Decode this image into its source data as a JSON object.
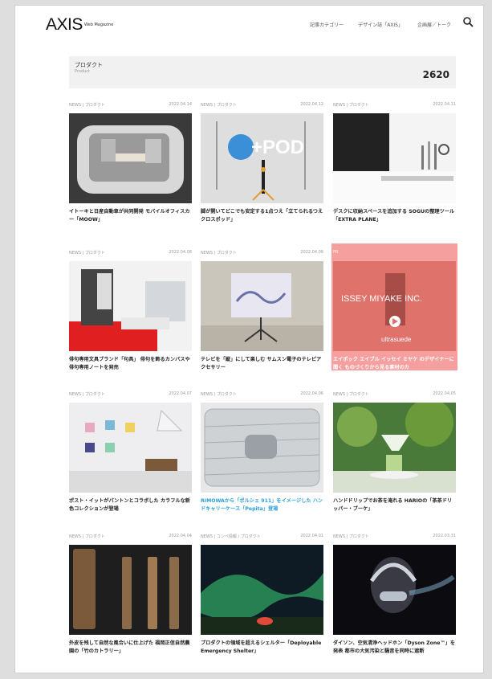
{
  "header": {
    "logo": "AXIS",
    "logo_sub": "Web Magazine",
    "nav": [
      "記事カテゴリー",
      "デザイン誌「AXIS」",
      "企画展／トーク"
    ]
  },
  "category": {
    "title": "プロダクト",
    "subtitle": "Product",
    "count": "2620"
  },
  "articles": [
    {
      "cat": "NEWS | プロダクト",
      "date": "2022.04.14",
      "title": "イトーキと日産自動車が共同開発 モバイルオフィスカー「MOOW」"
    },
    {
      "cat": "NEWS | プロダクト",
      "date": "2022.04.12",
      "title": "脚が開いてどこでも安定する1点つえ「立てられるつえ クロスポッド」"
    },
    {
      "cat": "NEWS | プロダクト",
      "date": "2022.04.11",
      "title": "デスクに収納スペースを追加する SOGUの整理ツール「EXTRA PLANE」"
    },
    {
      "cat": "NEWS | プロダクト",
      "date": "2022.04.08",
      "title": "俳句専用文具ブランド「句具」 俳句を飾るカンバスや俳句専用ノートを発売"
    },
    {
      "cat": "NEWS | プロダクト",
      "date": "2022.04.08",
      "title": "テレビを「縦」にして楽しむ サムスン電子のテレビアクセサリー"
    },
    {
      "cat": "PR",
      "date": "",
      "title": "エイポック エイブル イッセイ ミヤケ のデザイナーに聞く ものづくりから見る素材のカ"
    },
    {
      "cat": "NEWS | プロダクト",
      "date": "2022.04.07",
      "title": "ポスト・イットがパントンとコラボした カラフルな新色コレクションが登場"
    },
    {
      "cat": "NEWS | プロダクト",
      "date": "2022.04.06",
      "title": "RIMOWAから「ポルシェ 911」をイメージした ハンドキャリーケース「Pepita」登場"
    },
    {
      "cat": "NEWS | プロダクト",
      "date": "2022.04.05",
      "title": "ハンドドリップでお茶を淹れる HARIOの「茶茶ドリッパー・ブーケ」"
    },
    {
      "cat": "NEWS | プロダクト",
      "date": "2022.04.04",
      "title": "外皮を残して自然な風合いに仕上げた 福岡正信自然農園の「竹のカトラリー」"
    },
    {
      "cat": "NEWS | コンペ情報 / プロダクト",
      "date": "2022.04.01",
      "title": "プロダクトの領域を超えるシェルター「Deployable Emergency Shelter」"
    },
    {
      "cat": "NEWS | プロダクト",
      "date": "2022.03.31",
      "title": "ダイソン、空気清浄ヘッドホン「Dyson Zone™」を発表 都市の大気汚染と騒音を同時に遮断"
    }
  ],
  "thumb_text": {
    "pod": "+POD",
    "issey": "ISSEY MIYAKE INC.",
    "issey_sub": "ultrasuede"
  },
  "colors": {
    "pr_overlay": "#ec5050",
    "link": "#2aa0d8"
  }
}
